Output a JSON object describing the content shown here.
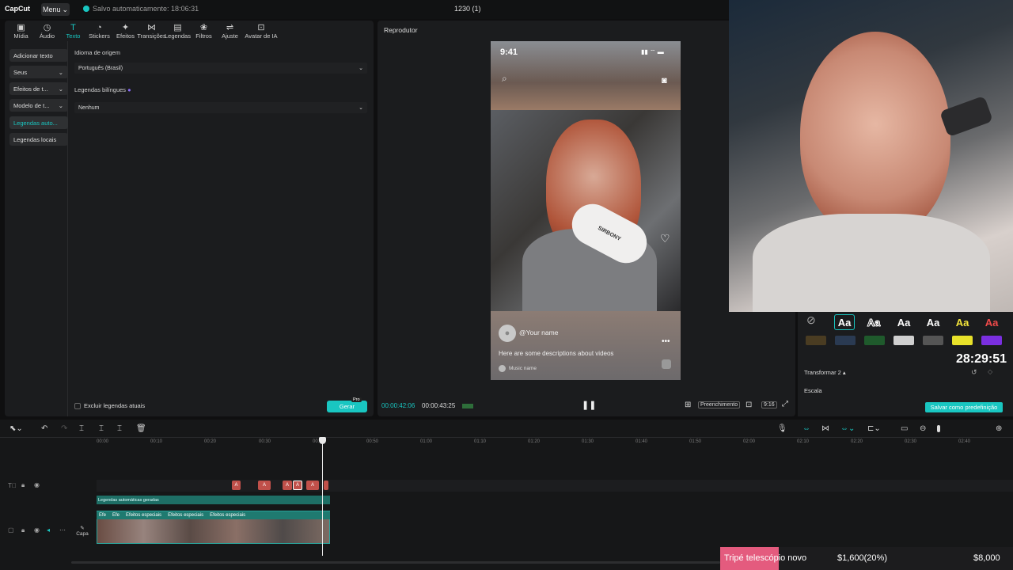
{
  "topbar": {
    "logo": "CapCut",
    "menu_label": "Menu",
    "save_status": "Salvo automaticamente: 18:06:31",
    "project_title": "1230 (1)"
  },
  "tool_tabs": [
    {
      "label": "Mídia",
      "icon": "media-icon"
    },
    {
      "label": "Áudio",
      "icon": "audio-icon"
    },
    {
      "label": "Texto",
      "icon": "text-icon",
      "active": true
    },
    {
      "label": "Stickers",
      "icon": "sticker-icon"
    },
    {
      "label": "Efeitos",
      "icon": "effects-icon"
    },
    {
      "label": "Transições",
      "icon": "transitions-icon"
    },
    {
      "label": "Legendas",
      "icon": "captions-icon"
    },
    {
      "label": "Filtros",
      "icon": "filters-icon"
    },
    {
      "label": "Ajuste",
      "icon": "adjust-icon"
    },
    {
      "label": "Avatar de IA",
      "icon": "ai-avatar-icon"
    }
  ],
  "side_menu": [
    {
      "label": "Adicionar texto"
    },
    {
      "label": "Seus"
    },
    {
      "label": "Efeitos de t..."
    },
    {
      "label": "Modelo de t..."
    },
    {
      "label": "Legendas auto..."
    },
    {
      "label": "Legendas locais"
    }
  ],
  "captions": {
    "source_language_label": "Idioma de origem",
    "source_language_value": "Português (Brasil)",
    "bilingual_label": "Legendas bilíngues",
    "bilingual_value": "Nenhum",
    "exclude_label": "Excluir legendas atuais",
    "generate_label": "Gerar",
    "pro_badge": "Pro"
  },
  "player": {
    "title": "Reprodutor",
    "phone_time": "9:41",
    "your_name": "@Your name",
    "description": "Here are some descriptions about videos",
    "music": "Music name",
    "brand_on_mic": "SIRBONY",
    "current_time": "00:00:42:06",
    "total_time": "00:00:43:25",
    "fill_label": "Preenchimento",
    "ratio_label": "9:16"
  },
  "style_panel": {
    "presets": [
      "Aa",
      "Aa",
      "Aa",
      "Aa",
      "Aa",
      "Aa"
    ],
    "transform_label": "Transformar 2",
    "scale_label": "Escala",
    "save_preset_label": "Salvar como predefinição"
  },
  "overlay": {
    "clock": "28:29:51"
  },
  "timeline": {
    "ticks": [
      "00:00",
      "00:10",
      "00:20",
      "00:30",
      "00:40",
      "00:50",
      "01:00",
      "01:10",
      "01:20",
      "01:30",
      "01:40",
      "01:50",
      "02:00",
      "02:10",
      "02:20",
      "02:30",
      "02:40"
    ],
    "caption_clip_label": "A",
    "effects_label": "Efeitos especiais",
    "effects_short": "Efe",
    "subtitle_strip": "Legendas automáticas geradas",
    "capa_label": "Capa"
  },
  "donation_goal": {
    "label": "Tripé telescópio novo",
    "amount": "$1,600(20%)",
    "target": "$8,000",
    "progress_fraction": 0.2,
    "fill_color": "#e45b7e"
  },
  "colors": {
    "accent": "#19c6c1",
    "caption_clip": "#c0504a",
    "track_teal": "#1f7a70"
  }
}
